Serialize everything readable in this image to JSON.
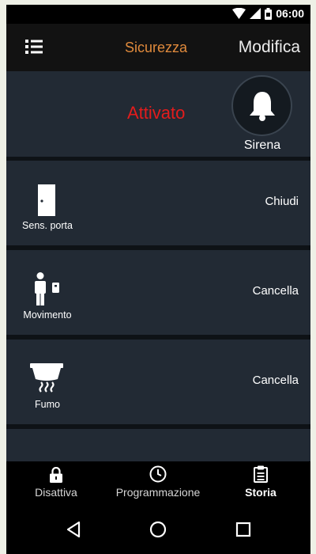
{
  "status_bar": {
    "time": "06:00",
    "icons": [
      "wifi-icon",
      "signal-icon",
      "battery-icon"
    ]
  },
  "app_bar": {
    "title": "Sicurezza",
    "edit_label": "Modifica",
    "menu_icon": "menu-list-icon"
  },
  "alarm": {
    "status": "Attivato",
    "siren_label": "Sirena",
    "siren_icon": "bell-icon"
  },
  "devices": [
    {
      "label": "Sens. porta",
      "action": "Chiudi",
      "icon": "door-icon"
    },
    {
      "label": "Movimento",
      "action": "Cancella",
      "icon": "motion-sensor-icon"
    },
    {
      "label": "Fumo",
      "action": "Cancella",
      "icon": "smoke-detector-icon"
    },
    {
      "label": "",
      "action": "",
      "icon": "partial-device-icon"
    }
  ],
  "bottom_nav": {
    "items": [
      {
        "label": "Disattiva",
        "icon": "lock-icon",
        "active": false
      },
      {
        "label": "Programmazione",
        "icon": "clock-icon",
        "active": false
      },
      {
        "label": "Storia",
        "icon": "clipboard-icon",
        "active": true
      }
    ]
  },
  "system_nav": [
    "back-icon",
    "home-icon",
    "recents-icon"
  ],
  "colors": {
    "accent": "#e08a3c",
    "alarm_active": "#e31c1c",
    "row_background": "#222a34",
    "separator": "#0e1216"
  }
}
